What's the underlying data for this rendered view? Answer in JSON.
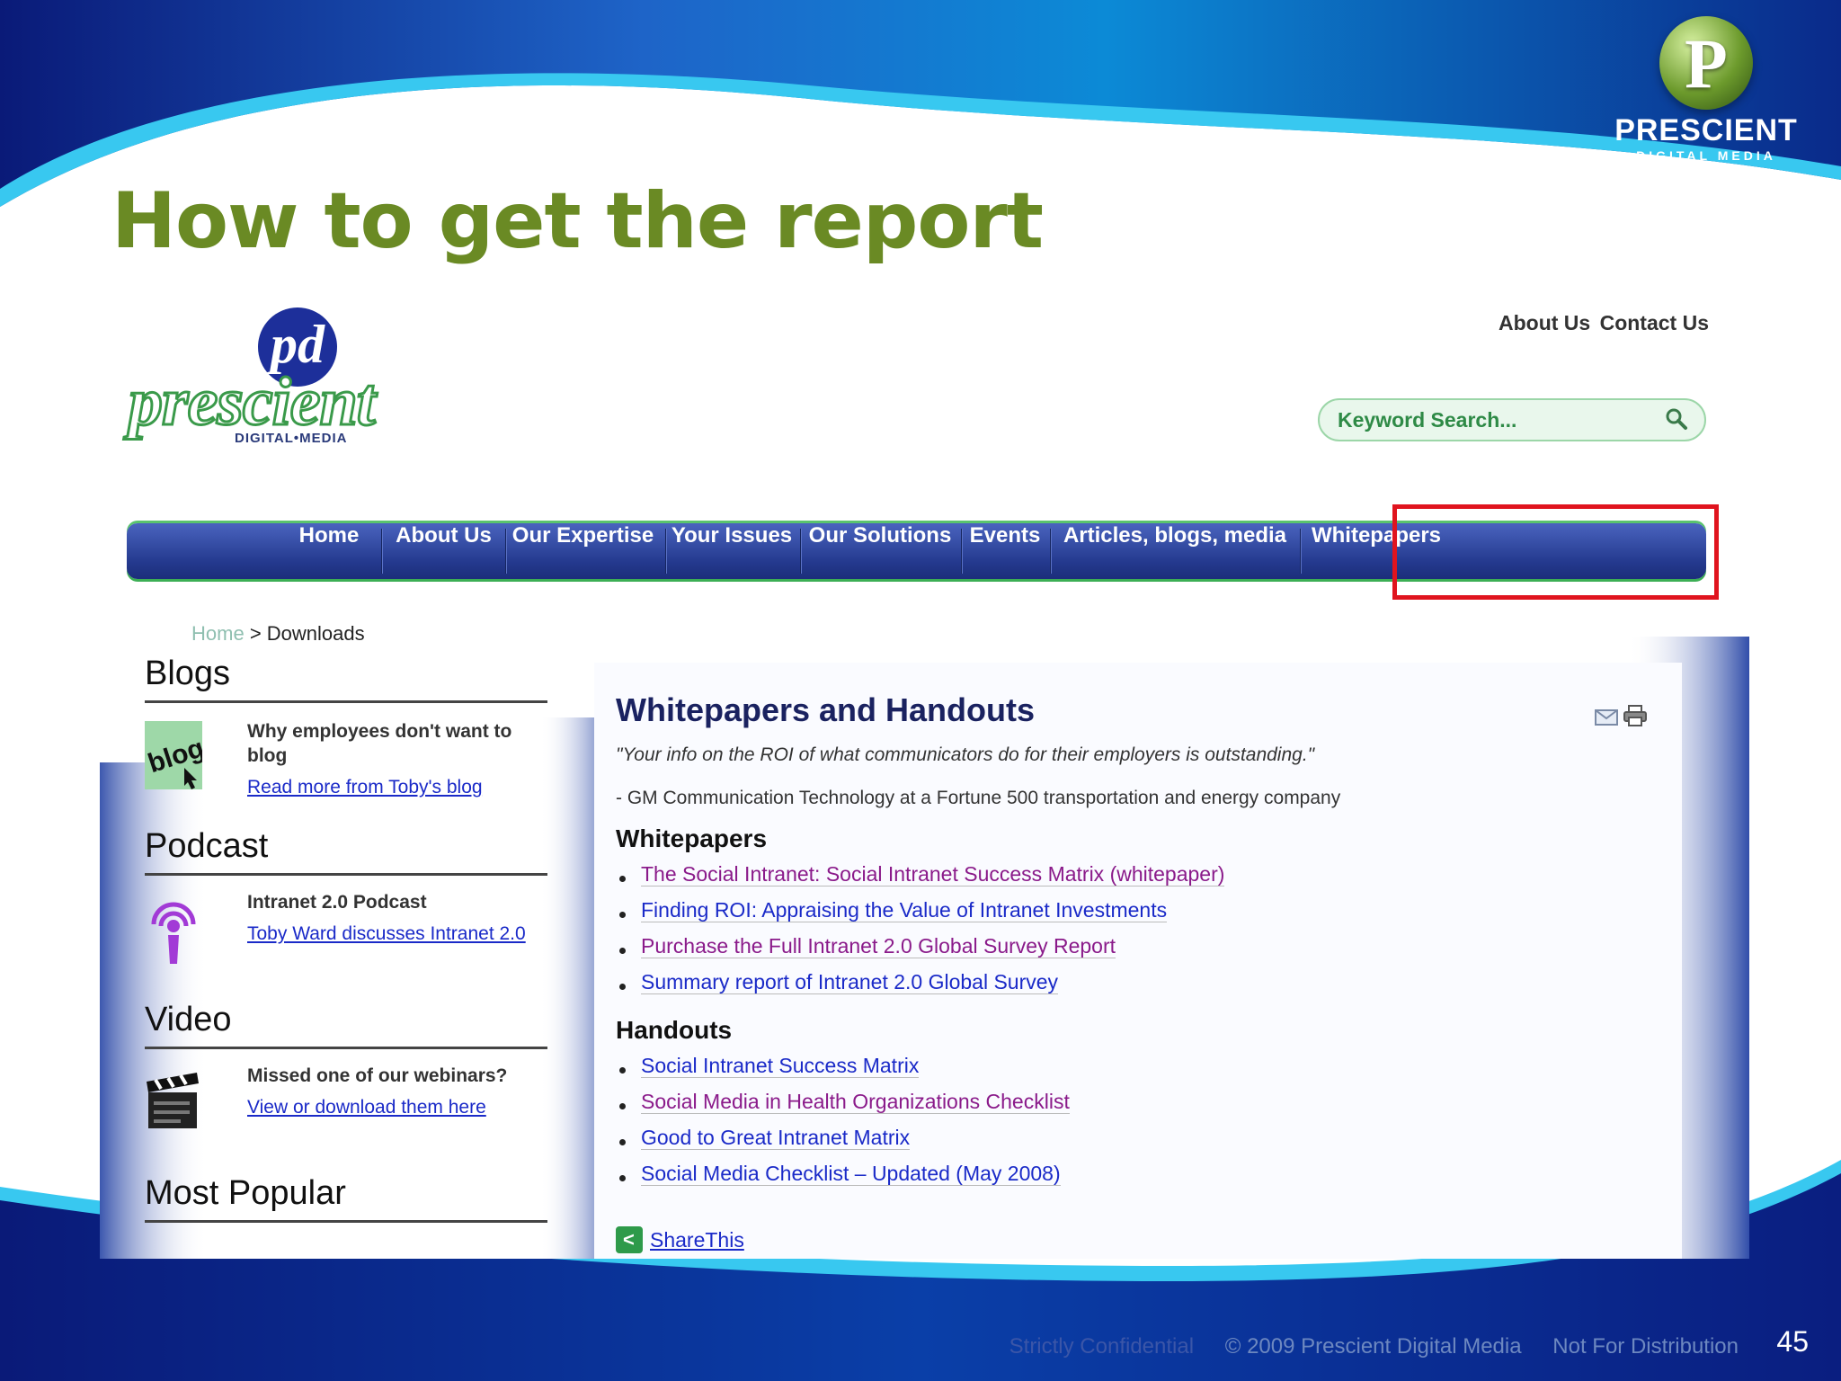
{
  "slide": {
    "title": "How to get the report",
    "brand_name": "PRESCIENT",
    "brand_sub": "DIGITAL MEDIA",
    "page_number": "45",
    "footer": {
      "confidential": "Strictly Confidential",
      "copyright": "© 2009 Prescient Digital Media",
      "distribution": "Not For Distribution"
    }
  },
  "website": {
    "logo_mark": "pd",
    "logo_word": "prescient",
    "logo_tag": "DIGITAL•MEDIA",
    "top_links": [
      "About Us",
      "Contact Us"
    ],
    "search_placeholder": "Keyword Search...",
    "nav": [
      "Home",
      "About Us",
      "Our Expertise",
      "Your Issues",
      "Our Solutions",
      "Events",
      "Articles, blogs, media",
      "Whitepapers"
    ],
    "highlighted_nav": "Whitepapers",
    "breadcrumb": {
      "home": "Home",
      "sep": ">",
      "current": "Downloads"
    },
    "sidebar": {
      "blogs": {
        "title": "Blogs",
        "text": "Why employees don't want to blog",
        "link": "Read more from Toby's blog"
      },
      "podcast": {
        "title": "Podcast",
        "text": "Intranet 2.0 Podcast",
        "link": "Toby Ward discusses Intranet 2.0"
      },
      "video": {
        "title": "Video",
        "text": "Missed one of our webinars?",
        "link": "View or download them here"
      },
      "popular": {
        "title": "Most Popular"
      }
    },
    "content": {
      "title": "Whitepapers and Handouts",
      "quote": "\"Your info on the ROI of what communicators do for their employers is outstanding.\"",
      "attribution": "- GM Communication Technology at a Fortune 500 transportation and energy company",
      "whitepapers_heading": "Whitepapers",
      "whitepapers": [
        "The Social Intranet: Social Intranet Success Matrix (whitepaper)",
        "Finding ROI: Appraising the Value of Intranet Investments",
        "Purchase the Full Intranet 2.0 Global Survey Report",
        "Summary report of Intranet 2.0 Global Survey"
      ],
      "handouts_heading": "Handouts",
      "handouts": [
        "Social Intranet Success Matrix",
        "Social Media in Health Organizations Checklist",
        "Good to Great Intranet Matrix",
        "Social Media Checklist – Updated (May 2008)"
      ],
      "share": "ShareThis"
    },
    "colors": {
      "visited_link": "#8a1a8a",
      "link": "#1a2ac8",
      "nav": "#2a3f96",
      "highlight": "#e0141e"
    }
  }
}
